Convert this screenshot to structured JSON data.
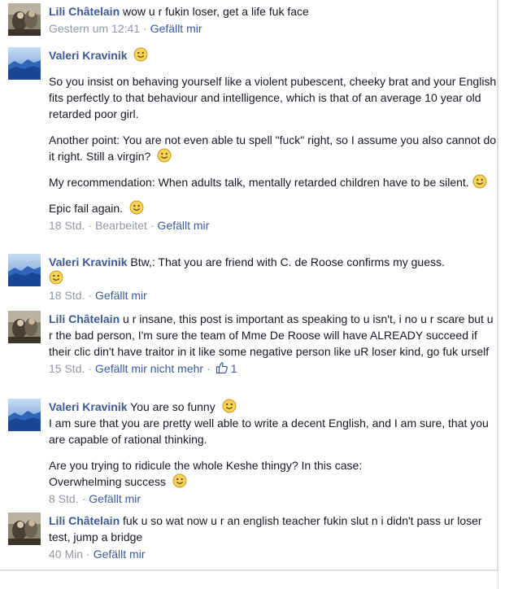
{
  "comments": [
    {
      "author": "Lili Châtelain",
      "avatar": "photo-avatar",
      "paragraphs": [
        "wow u r fukin loser, get a life fuk face"
      ],
      "time": "Gestern um 12:41",
      "actions": [
        "Gefällt mir"
      ]
    },
    {
      "author": "Valeri Kravinik",
      "avatar": "landscape-avatar",
      "paragraphs": [
        "So you insist on behaving yourself like a violent pubescent, cheeky brat and your English fits perfectly to that behaviour and intelligence, which is that of an average 10 year old retarded poor girl.",
        "Another point: You are not even able tu spell \"fuck\" right, so I assume you also cannot do it right. Still a virgin?",
        "My recommendation: When adults talk, mentally retarded children have to be silent.",
        "Epic fail again."
      ],
      "time": "18 Std.",
      "edited": "Bearbeitet",
      "actions": [
        "Gefällt mir"
      ]
    },
    {
      "author": "Valeri Kravinik",
      "avatar": "landscape-avatar",
      "paragraphs": [
        "Btw,: That you are friend with C. de Roose confirms my guess."
      ],
      "time": "18 Std.",
      "actions": [
        "Gefällt mir"
      ]
    },
    {
      "author": "Lili Châtelain",
      "avatar": "photo-avatar",
      "paragraphs": [
        "u r insane, this post is important as speaking to u isn't, i no u r scare but u r the bad person, I'm sure the team of Mme De Roose will have ALREADY succeed if their clic din't have traitor in it like some negative person like uR loser kind, go fuk urself"
      ],
      "time": "15 Std.",
      "actions": [
        "Gefällt mir nicht mehr"
      ],
      "like_count": "1"
    },
    {
      "author": "Valeri Kravinik",
      "avatar": "landscape-avatar",
      "paragraphs": [
        "You are so funny",
        "I am sure that you are pretty well able to write a decent English, and I am sure, that you are capable of rational thinking.",
        "Are you trying to ridicule the whole Keshe thingy? In this case:",
        "Overwhelming success"
      ],
      "time": "8 Std.",
      "actions": [
        "Gefällt mir"
      ]
    },
    {
      "author": "Lili Châtelain",
      "avatar": "photo-avatar",
      "paragraphs": [
        "fuk u so wat now u r an english teacher fukin slut n i didn't pass ur loser test, jump a bridge"
      ],
      "time": "40 Min",
      "actions": [
        "Gefällt mir"
      ]
    }
  ],
  "colors": {
    "link": "#3b5998",
    "meta": "#9197a3",
    "text": "#141823"
  },
  "icons": {
    "smiley": "smiley-icon",
    "like": "thumbs-up-icon"
  }
}
